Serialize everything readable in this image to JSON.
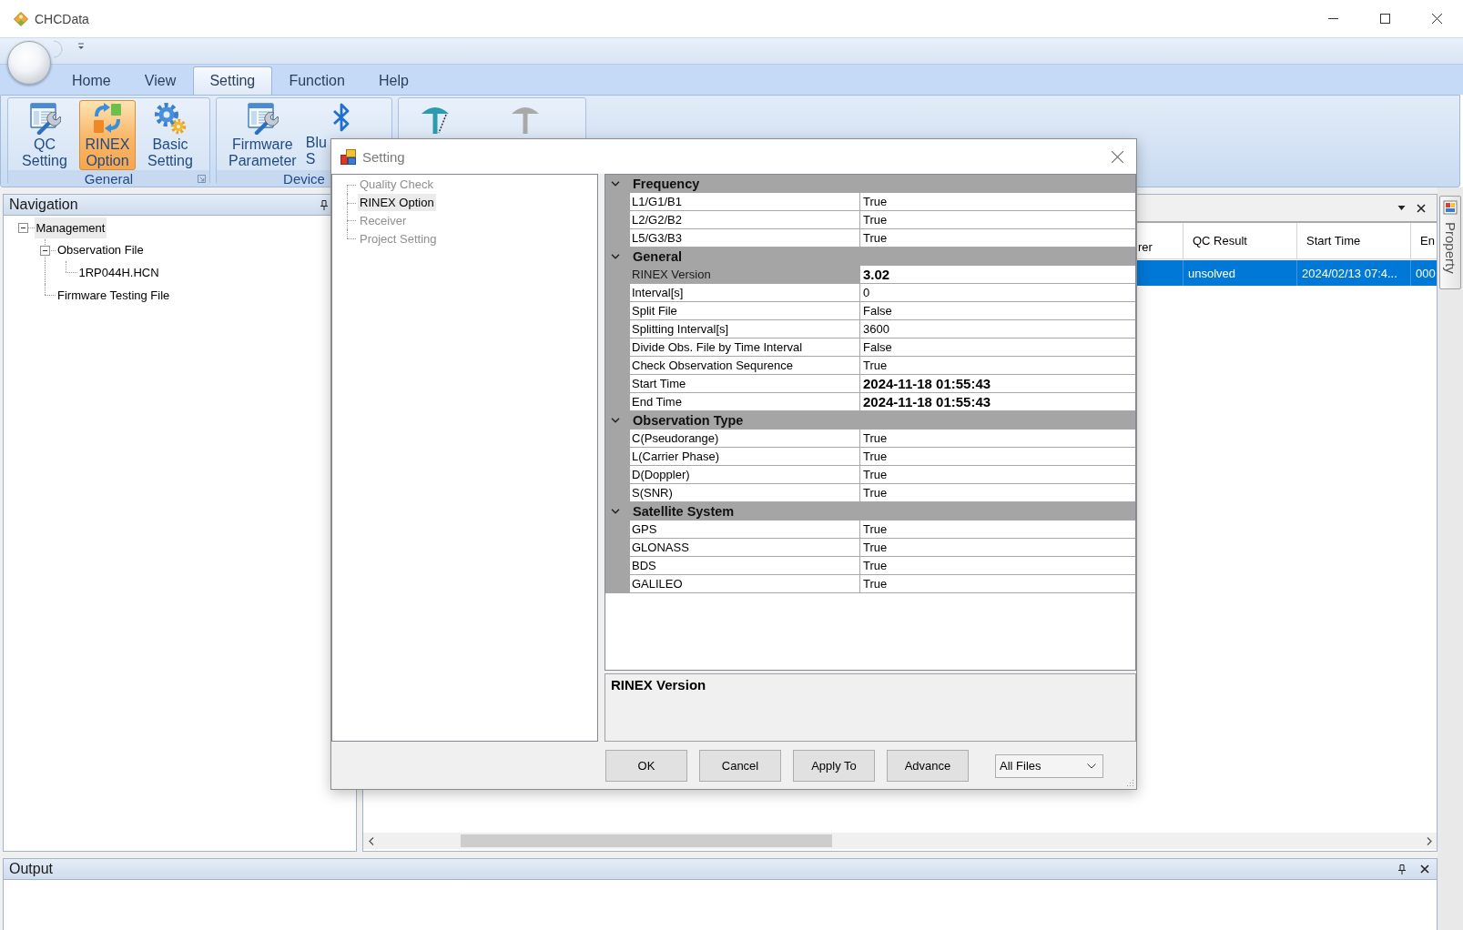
{
  "window": {
    "title": "CHCData"
  },
  "ribbon": {
    "tabs": [
      {
        "label": "Home",
        "selected": false
      },
      {
        "label": "View",
        "selected": false
      },
      {
        "label": "Setting",
        "selected": true
      },
      {
        "label": "Function",
        "selected": false
      },
      {
        "label": "Help",
        "selected": false
      }
    ],
    "groups": [
      {
        "label": "General",
        "launcher": true,
        "buttons": [
          {
            "kind": "checklist",
            "label": "QC Setting",
            "selected": false,
            "disabled": false
          },
          {
            "kind": "convert",
            "label": "RINEX Option",
            "selected": true,
            "disabled": false
          },
          {
            "kind": "gears",
            "label": "Basic Setting",
            "selected": false,
            "disabled": false
          }
        ]
      },
      {
        "label": "Device",
        "buttons": [
          {
            "kind": "checklist",
            "label": "Firmware Parameter",
            "selected": false,
            "disabled": false
          },
          {
            "kind": "bluetooth",
            "label": "Blu S",
            "selected": false,
            "disabled": false
          }
        ]
      },
      {
        "buttons": [
          {
            "kind": "antenna",
            "selected": false,
            "disabled": false
          },
          {
            "kind": "antenna",
            "selected": false,
            "disabled": true
          }
        ]
      }
    ]
  },
  "navigation": {
    "title": "Navigation",
    "tree": [
      {
        "label": "Management",
        "selected": true,
        "expanded": true,
        "children": [
          {
            "label": "Observation File",
            "selected": false,
            "expanded": true,
            "children": [
              {
                "label": "1RP044H.HCN",
                "selected": false
              }
            ]
          },
          {
            "label": "Firmware Testing File",
            "selected": false
          }
        ]
      }
    ]
  },
  "document": {
    "columns": [
      "rer",
      "QC Result",
      "Start Time",
      "En"
    ],
    "rows": [
      {
        "selected": true,
        "cells": [
          null,
          "unsolved",
          "2024/02/13 07:4...",
          "000"
        ]
      }
    ]
  },
  "side_panel": {
    "tab": "Property"
  },
  "output": {
    "title": "Output"
  },
  "dialog": {
    "title": "Setting",
    "tree": [
      {
        "label": "Quality Check",
        "selected": false,
        "disabled": true
      },
      {
        "label": "RINEX Option",
        "selected": true,
        "disabled": false
      },
      {
        "label": "Receiver",
        "selected": false,
        "disabled": true
      },
      {
        "label": "Project Setting",
        "selected": false,
        "disabled": true
      }
    ],
    "property_grid": {
      "categories": [
        {
          "name": "Frequency",
          "expanded": true,
          "properties": [
            {
              "name": "L1/G1/B1",
              "value": "True",
              "selected": false,
              "modified": false
            },
            {
              "name": "L2/G2/B2",
              "value": "True",
              "selected": false,
              "modified": false
            },
            {
              "name": "L5/G3/B3",
              "value": "True",
              "selected": false,
              "modified": false
            }
          ]
        },
        {
          "name": "General",
          "expanded": true,
          "properties": [
            {
              "name": "RINEX Version",
              "value": "3.02",
              "selected": true,
              "modified": true
            },
            {
              "name": "Interval[s]",
              "value": "0",
              "selected": false,
              "modified": false
            },
            {
              "name": "Split File",
              "value": "False",
              "selected": false,
              "modified": false
            },
            {
              "name": "Splitting Interval[s]",
              "value": "3600",
              "selected": false,
              "modified": false
            },
            {
              "name": "Divide Obs. File by Time Interval",
              "value": "False",
              "selected": false,
              "modified": false
            },
            {
              "name": "Check Observation Sequrence",
              "value": "True",
              "selected": false,
              "modified": false
            },
            {
              "name": "Start Time",
              "value": "2024-11-18 01:55:43",
              "selected": false,
              "modified": true
            },
            {
              "name": "End Time",
              "value": "2024-11-18 01:55:43",
              "selected": false,
              "modified": true
            }
          ]
        },
        {
          "name": "Observation Type",
          "expanded": true,
          "properties": [
            {
              "name": "C(Pseudorange)",
              "value": "True",
              "selected": false,
              "modified": false
            },
            {
              "name": "L(Carrier Phase)",
              "value": "True",
              "selected": false,
              "modified": false
            },
            {
              "name": "D(Doppler)",
              "value": "True",
              "selected": false,
              "modified": false
            },
            {
              "name": "S(SNR)",
              "value": "True",
              "selected": false,
              "modified": false
            }
          ]
        },
        {
          "name": "Satellite System",
          "expanded": true,
          "properties": [
            {
              "name": "GPS",
              "value": "True",
              "selected": false,
              "modified": false
            },
            {
              "name": "GLONASS",
              "value": "True",
              "selected": false,
              "modified": false
            },
            {
              "name": "BDS",
              "value": "True",
              "selected": false,
              "modified": false
            },
            {
              "name": "GALILEO",
              "value": "True",
              "selected": false,
              "modified": false
            }
          ]
        }
      ]
    },
    "description": {
      "title": "RINEX Version"
    },
    "buttons": [
      "OK",
      "Cancel",
      "Apply To",
      "Advance"
    ],
    "filter": {
      "value": "All Files"
    }
  }
}
